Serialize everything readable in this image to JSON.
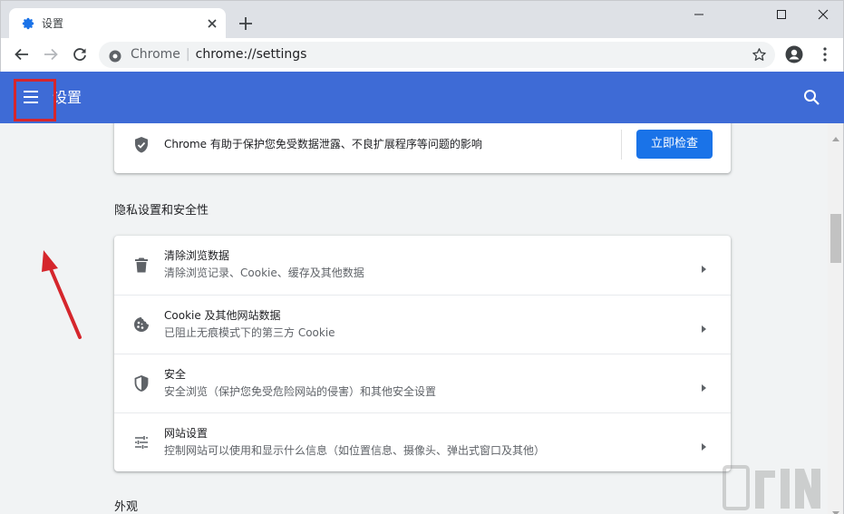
{
  "tab": {
    "title": "设置",
    "icon": "gear-icon"
  },
  "window_controls": [
    "minimize-icon",
    "maximize-icon",
    "close-icon"
  ],
  "omnibox": {
    "site_name": "Chrome",
    "url": "chrome://settings"
  },
  "header": {
    "title": "设置",
    "menu_icon": "hamburger-menu-icon",
    "search_icon": "search-icon"
  },
  "safety_check": {
    "text": "Chrome 有助于保护您免受数据泄露、不良扩展程序等问题的影响",
    "button": "立即检查"
  },
  "privacy_section": {
    "title": "隐私设置和安全性",
    "rows": [
      {
        "title": "清除浏览数据",
        "subtitle": "清除浏览记录、Cookie、缓存及其他数据",
        "icon": "trash-icon"
      },
      {
        "title": "Cookie 及其他网站数据",
        "subtitle": "已阻止无痕模式下的第三方 Cookie",
        "icon": "cookie-icon"
      },
      {
        "title": "安全",
        "subtitle": "安全浏览（保护您免受危险网站的侵害）和其他安全设置",
        "icon": "shield-icon"
      },
      {
        "title": "网站设置",
        "subtitle": "控制网站可以使用和显示什么信息（如位置信息、摄像头、弹出式窗口及其他）",
        "icon": "sliders-icon"
      }
    ]
  },
  "appearance_section": {
    "title": "外观"
  },
  "colors": {
    "header_blue": "#3e6bd6",
    "button_blue": "#1a73e8",
    "annotation_red": "#d5262c"
  }
}
